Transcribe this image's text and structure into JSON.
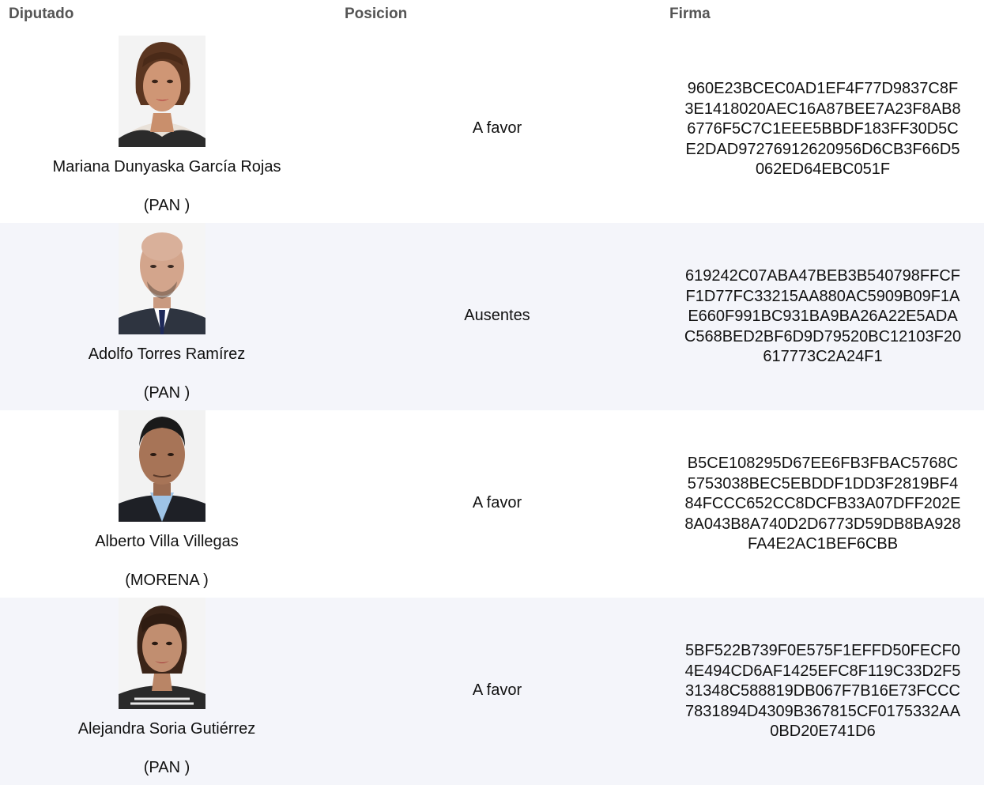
{
  "header": {
    "diputado": "Diputado",
    "posicion": "Posicion",
    "firma": "Firma"
  },
  "rows": [
    {
      "name": "Mariana Dunyaska García Rojas",
      "party": "(PAN )",
      "position": "A favor",
      "firma": [
        "960E23BCEC0AD1EF4F77D9837C8F",
        "3E1418020AEC16A87BEE7A23F8AB8",
        "6776F5C7C1EEE5BBDF183FF30D5C",
        "E2DAD97276912620956D6CB3F66D5",
        "062ED64EBC051F"
      ]
    },
    {
      "name": "Adolfo Torres Ramírez",
      "party": "(PAN )",
      "position": "Ausentes",
      "firma": [
        "619242C07ABA47BEB3B540798FFCF",
        "F1D77FC33215AA880AC5909B09F1A",
        "E660F991BC931BA9BA26A22E5ADA",
        "C568BED2BF6D9D79520BC12103F20",
        "617773C2A24F1"
      ]
    },
    {
      "name": "Alberto Villa Villegas",
      "party": "(MORENA )",
      "position": "A favor",
      "firma": [
        "B5CE108295D67EE6FB3FBAC5768C",
        "5753038BEC5EBDDF1DD3F2819BF4",
        "84FCCC652CC8DCFB33A07DFF202E",
        "8A043B8A740D2D6773D59DB8BA928",
        "FA4E2AC1BEF6CBB"
      ]
    },
    {
      "name": "Alejandra Soria Gutiérrez",
      "party": "(PAN )",
      "position": "A favor",
      "firma": [
        "5BF522B739F0E575F1EFFD50FECF0",
        "4E494CD6AF1425EFC8F119C33D2F5",
        "31348C588819DB067F7B16E73FCCC",
        "7831894D4309B367815CF0175332AA",
        "0BD20E741D6"
      ]
    }
  ]
}
